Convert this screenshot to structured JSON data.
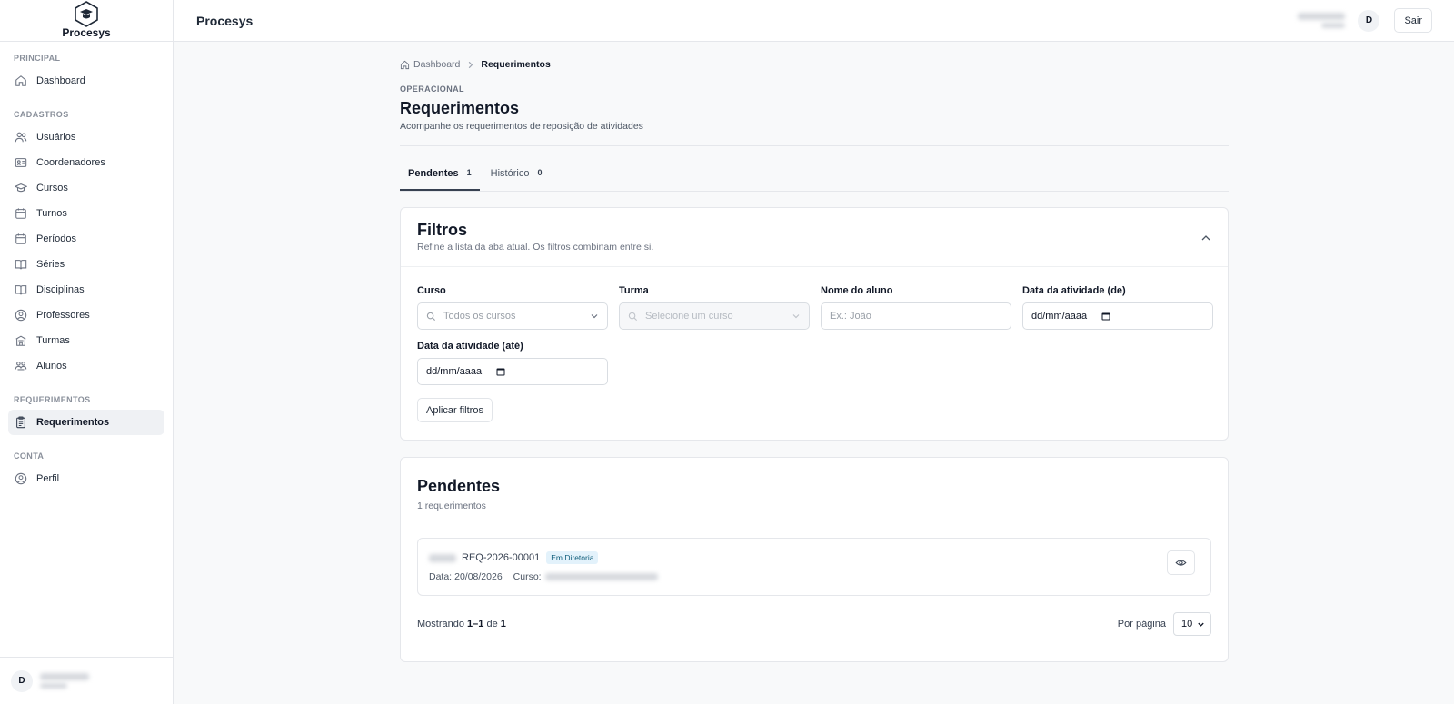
{
  "app": {
    "name": "Procesys",
    "header_title": "Procesys"
  },
  "header": {
    "avatar_initial": "D",
    "logout_label": "Sair"
  },
  "sidebar": {
    "sections": [
      {
        "label": "PRINCIPAL",
        "items": [
          {
            "label": "Dashboard",
            "icon": "home-icon"
          }
        ]
      },
      {
        "label": "CADASTROS",
        "items": [
          {
            "label": "Usuários",
            "icon": "users-icon"
          },
          {
            "label": "Coordenadores",
            "icon": "id-card-icon"
          },
          {
            "label": "Cursos",
            "icon": "graduation-cap-icon"
          },
          {
            "label": "Turnos",
            "icon": "calendar-icon"
          },
          {
            "label": "Períodos",
            "icon": "calendar-icon"
          },
          {
            "label": "Séries",
            "icon": "book-open-icon"
          },
          {
            "label": "Disciplinas",
            "icon": "book-open-icon"
          },
          {
            "label": "Professores",
            "icon": "user-circle-icon"
          },
          {
            "label": "Turmas",
            "icon": "school-icon"
          },
          {
            "label": "Alunos",
            "icon": "students-icon"
          }
        ]
      },
      {
        "label": "REQUERIMENTOS",
        "items": [
          {
            "label": "Requerimentos",
            "icon": "clipboard-icon",
            "active": true
          }
        ]
      },
      {
        "label": "CONTA",
        "items": [
          {
            "label": "Perfil",
            "icon": "user-circle-icon"
          }
        ]
      }
    ],
    "footer_avatar_initial": "D"
  },
  "breadcrumb": {
    "home": "Dashboard",
    "current": "Requerimentos"
  },
  "page": {
    "eyebrow": "OPERACIONAL",
    "title": "Requerimentos",
    "subtitle": "Acompanhe os requerimentos de reposição de atividades"
  },
  "tabs": [
    {
      "label": "Pendentes",
      "count": "1",
      "active": true
    },
    {
      "label": "Histórico",
      "count": "0",
      "active": false
    }
  ],
  "filters": {
    "title": "Filtros",
    "description": "Refine a lista da aba atual. Os filtros combinam entre si.",
    "curso": {
      "label": "Curso",
      "placeholder": "Todos os cursos"
    },
    "turma": {
      "label": "Turma",
      "placeholder": "Selecione um curso"
    },
    "aluno": {
      "label": "Nome do aluno",
      "placeholder": "Ex.: João"
    },
    "data_de": {
      "label": "Data da atividade (de)",
      "value": "dd/mm/aaaa"
    },
    "data_ate": {
      "label": "Data da atividade (até)",
      "value": "dd/mm/aaaa"
    },
    "apply_label": "Aplicar filtros"
  },
  "list": {
    "title": "Pendentes",
    "subtitle": "1 requerimentos",
    "items": [
      {
        "code": "REQ-2026-00001",
        "status": "Em Diretoria",
        "date_label": "Data:",
        "date": "20/08/2026",
        "course_label": "Curso:"
      }
    ],
    "footer": {
      "showing_prefix": "Mostrando",
      "range": "1–1",
      "of": "de",
      "total": "1"
    },
    "per_page_label": "Por página",
    "per_page_value": "10"
  },
  "colors": {
    "badge_bg": "#e3f2fb",
    "badge_text": "#0f5d7a",
    "active_nav_bg": "#eff1f4"
  }
}
